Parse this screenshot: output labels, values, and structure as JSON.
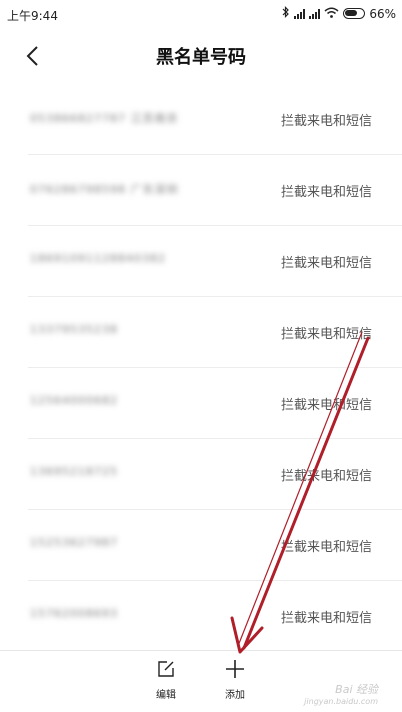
{
  "status_bar": {
    "time": "上午9:44",
    "battery": "66%"
  },
  "header": {
    "title": "黑名单号码"
  },
  "blacklist": [
    {
      "number": "053866827787 江苏南京",
      "status": "拦截来电和短信"
    },
    {
      "number": "076286798598 广东深圳",
      "status": "拦截来电和短信"
    },
    {
      "number": "18691091128840382",
      "status": "拦截来电和短信"
    },
    {
      "number": "13379535238",
      "status": "拦截来电和短信"
    },
    {
      "number": "12564000682",
      "status": "拦截来电和短信"
    },
    {
      "number": "13695218725",
      "status": "拦截来电和短信"
    },
    {
      "number": "15253627987",
      "status": "拦截来电和短信"
    },
    {
      "number": "15762008693",
      "status": "拦截来电和短信"
    }
  ],
  "toolbar": {
    "edit_label": "编辑",
    "add_label": "添加"
  },
  "watermark": {
    "site": "Bai 经验",
    "url": "jingyan.baidu.com"
  },
  "annotation": {
    "color": "#b01e2a"
  }
}
